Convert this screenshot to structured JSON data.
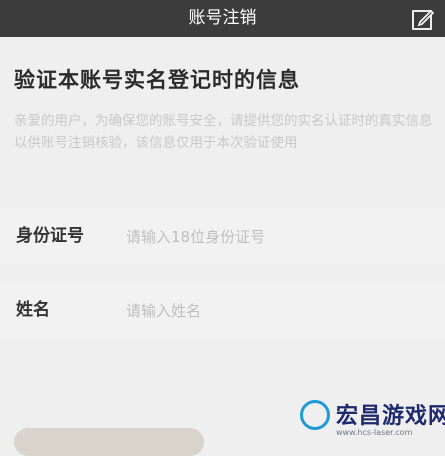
{
  "header": {
    "title": "账号注销",
    "edit_icon": "edit-icon"
  },
  "main": {
    "heading": "验证本账号实名登记时的信息",
    "description": "亲爱的用户，为确保您的账号安全，请提供您的实名认证时的真实信息以供账号注销核验，该信息仅用于本次验证使用"
  },
  "form": {
    "id_label": "身份证号",
    "id_placeholder": "请输入18位身份证号",
    "name_label": "姓名",
    "name_placeholder": "请输入姓名"
  },
  "watermark": {
    "text": "宏昌游戏网",
    "url": "www.hcs-laser.com"
  },
  "colors": {
    "topbar": "#3c3c3c",
    "background": "#efefef",
    "button": "#d8d4cc"
  }
}
